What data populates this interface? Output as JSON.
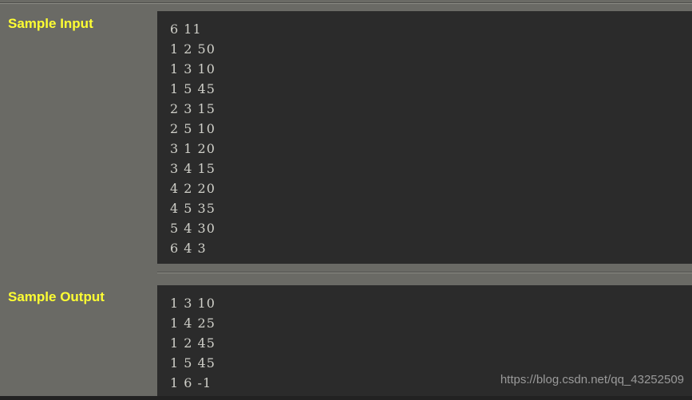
{
  "page": {
    "background_color": "#6a6a65",
    "code_background_color": "#2b2b2b",
    "label_color": "#ffff33",
    "code_text_color": "#cfcfc8"
  },
  "sections": [
    {
      "label": "Sample Input",
      "code": "6 11\n1 2 50\n1 3 10\n1 5 45\n2 3 15\n2 5 10\n3 1 20\n3 4 15\n4 2 20\n4 5 35\n5 4 30\n6 4 3"
    },
    {
      "label": "Sample Output",
      "code": "1 3 10\n1 4 25\n1 2 45\n1 5 45\n1 6 -1"
    }
  ],
  "watermark": {
    "text": "https://blog.csdn.net/qq_43252509"
  }
}
